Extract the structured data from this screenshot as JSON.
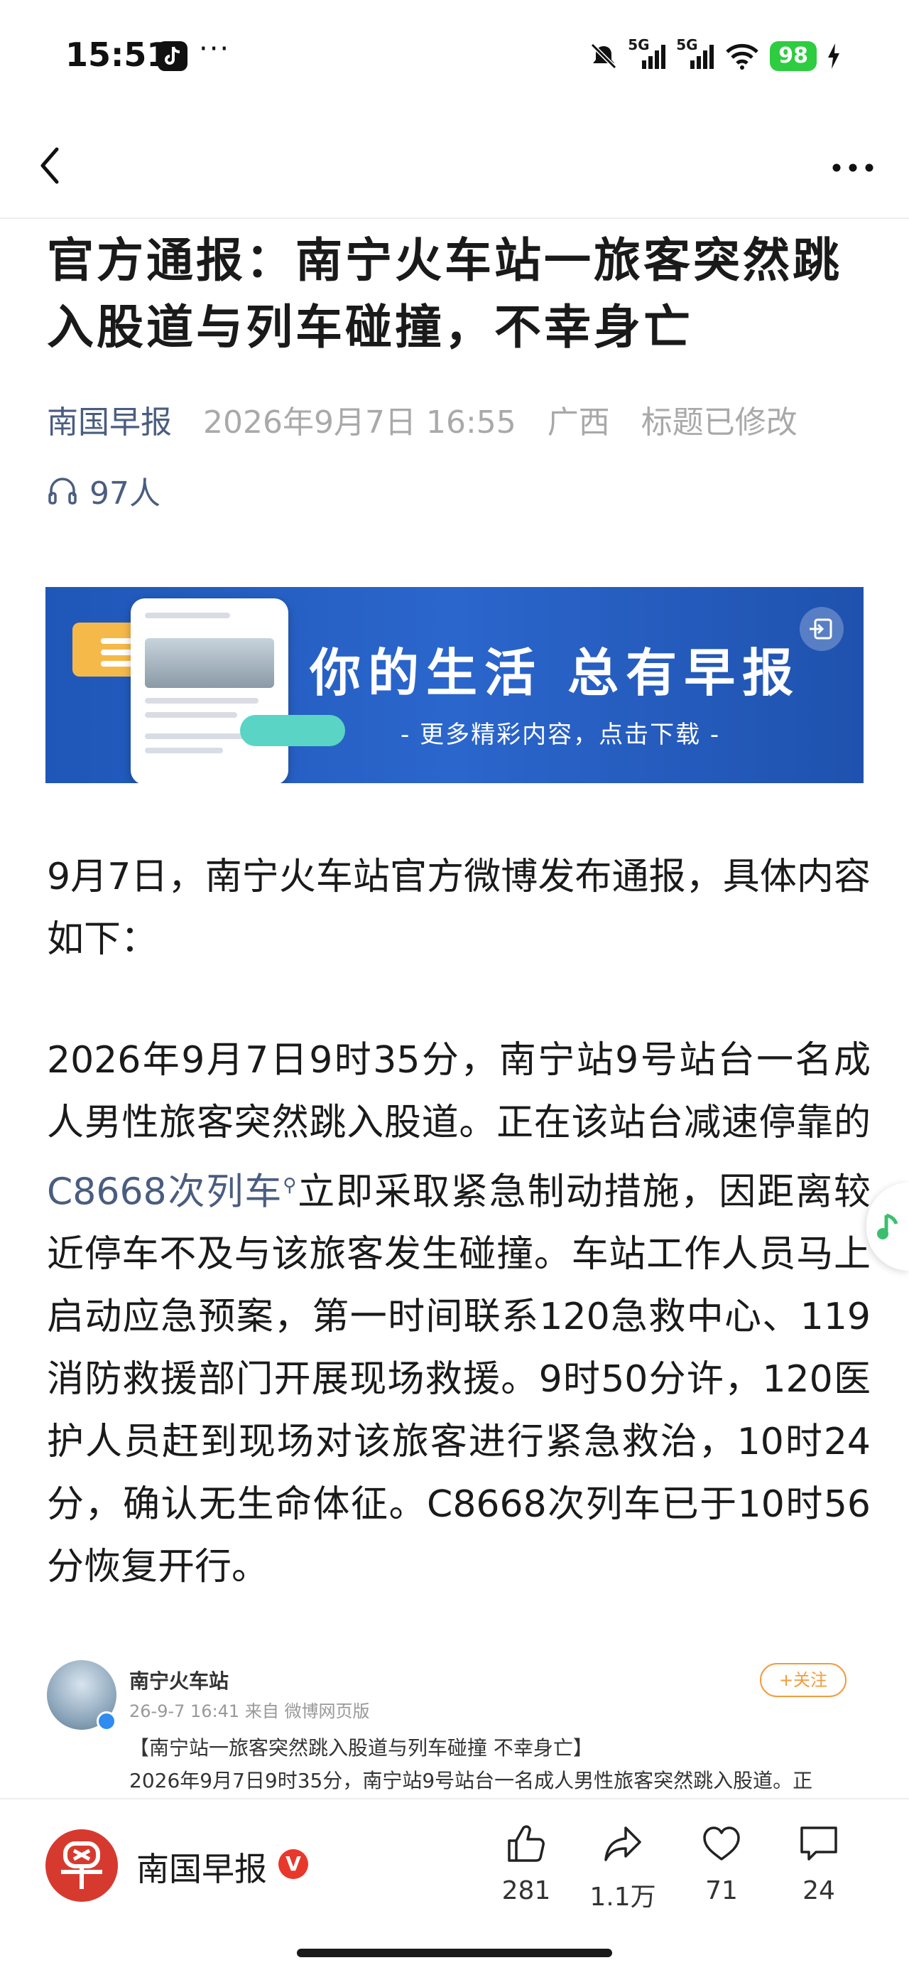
{
  "status_bar": {
    "time": "15:51",
    "more": "···",
    "signal1": "5G",
    "signal2": "5G",
    "battery": "98",
    "icons": [
      "tiktok-icon",
      "mute-icon",
      "signal-icon",
      "wifi-icon",
      "charging-icon"
    ]
  },
  "nav": {
    "back_icon": "chevron-left-icon",
    "more_icon": "more-horizontal-icon"
  },
  "article": {
    "title": "官方通报：南宁火车站一旅客突然跳入股道与列车碰撞，不幸身亡",
    "source": "南国早报",
    "date": "2026年9月7日 16:55",
    "region": "广西",
    "modified": "标题已修改",
    "listeners": "97人"
  },
  "banner": {
    "slogan": "你的生活 总有早报",
    "sub": "- 更多精彩内容，点击下载 -"
  },
  "body": {
    "para1": "9月7日，南宁火车站官方微博发布通报，具体内容如下：",
    "para2_part1": "2026年9月7日9时35分，南宁站9号站台一名成人男性旅客突然跳入股道。正在该站台减速停靠的",
    "para2_link": "C8668次列车",
    "para2_part2": "立即采取紧急制动措施，因距离较近停车不及与该旅客发生碰撞。车站工作人员马上启动应急预案，第一时间联系120急救中心、119消防救援部门开展现场救援。9时50分许，120医护人员赶到现场对该旅客进行紧急救治，10时24分，确认无生命体征。C8668次列车已于10时56分恢复开行。"
  },
  "weibo": {
    "name": "南宁火车站",
    "time": "26-9-7 16:41 来自 微博网页版",
    "follow": "+关注",
    "title": "【南宁站一旅客突然跳入股道与列车碰撞 不幸身亡】",
    "text": "2026年9月7日9时35分，南宁站9号站台一名成人男性旅客突然跳入股道。正"
  },
  "bottom": {
    "brand": "南国早报",
    "verified": "V",
    "like_count": "281",
    "share_count": "1.1万",
    "fav_count": "71",
    "comment_count": "24"
  },
  "colors": {
    "link": "#4a5d80",
    "meta_gray": "#a9a9a9",
    "banner_blue": "#2b66cc",
    "brand_red": "#d63a2f",
    "battery_green": "#2ecc40"
  }
}
